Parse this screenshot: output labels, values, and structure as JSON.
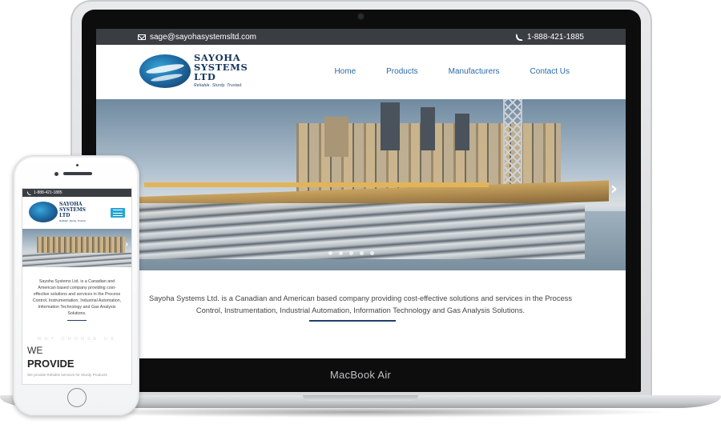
{
  "site": {
    "email": "sage@sayohasystemsltd.com",
    "phone": "1-888-421-1885",
    "logo": {
      "name_line1": "SAYOHA",
      "name_line2": "SYSTEMS",
      "name_line3": "LTD",
      "tagline": "Reliable. Sturdy. Trusted."
    },
    "nav": [
      {
        "label": "Home"
      },
      {
        "label": "Products"
      },
      {
        "label": "Manufacturers"
      },
      {
        "label": "Contact Us"
      }
    ],
    "hero": {
      "next_arrow": "›"
    },
    "intro": {
      "line1": "Sayoha Systems Ltd. is a Canadian and American based company providing cost-effective solutions and services in the Process",
      "line2": "Control, Instrumentation, Industrial Automation, Information Technology and Gas Analysis Solutions."
    }
  },
  "device": {
    "laptop_label": "MacBook Air"
  },
  "mobile": {
    "intro": "Sayoha Systems Ltd. is a Canadian and American based company providing cost-effective solutions and services in the Process Control, Instrumentation, Industrial Automation, Information Technology and Gas Analysis Solutions.",
    "why_choose": "WHY CHOOSE US",
    "we": "WE",
    "provide": "PROVIDE",
    "sub": "We provide Reliable services for Sturdy Products"
  },
  "colors": {
    "topbar": "#3a3d42",
    "brand_navy": "#14355d",
    "nav_link": "#2a6aa8",
    "mobile_menu": "#22a6d6"
  },
  "icons": [
    "envelope-icon",
    "phone-icon",
    "chevron-right-icon",
    "hamburger-menu-icon"
  ]
}
